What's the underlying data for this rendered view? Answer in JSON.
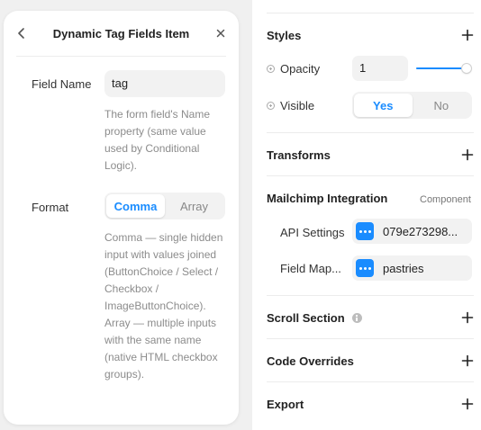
{
  "popup": {
    "title": "Dynamic Tag Fields Item",
    "field_name": {
      "label": "Field Name",
      "value": "tag",
      "help": "The form field's Name property (same value used by Conditional Logic)."
    },
    "format": {
      "label": "Format",
      "options": [
        "Comma",
        "Array"
      ],
      "selected": "Comma",
      "help": "Comma — single hidden input with values joined (ButtonChoice / Select / Checkbox / ImageButtonChoice). Array — multiple inputs with the same name (native HTML checkbox groups)."
    }
  },
  "panel": {
    "styles": {
      "title": "Styles",
      "opacity": {
        "label": "Opacity",
        "value": "1",
        "fraction": 1.0
      },
      "visible": {
        "label": "Visible",
        "options": [
          "Yes",
          "No"
        ],
        "selected": "Yes"
      }
    },
    "transforms": {
      "title": "Transforms"
    },
    "mailchimp": {
      "title": "Mailchimp Integration",
      "badge": "Component",
      "api_settings": {
        "label": "API Settings",
        "value": "079e273298..."
      },
      "field_map": {
        "label": "Field Map...",
        "value": "pastries"
      }
    },
    "scroll_section": {
      "title": "Scroll Section"
    },
    "code_overrides": {
      "title": "Code Overrides"
    },
    "export": {
      "title": "Export"
    }
  },
  "colors": {
    "accent": "#1a8cff",
    "background": "#f0f0f0",
    "surface": "#ffffff",
    "field_bg": "#f2f2f2",
    "muted_text": "#8c8c8c"
  },
  "icons": [
    "chevron-left-icon",
    "close-icon",
    "plus-icon",
    "add-circle-icon",
    "info-icon",
    "link-dots-icon"
  ]
}
